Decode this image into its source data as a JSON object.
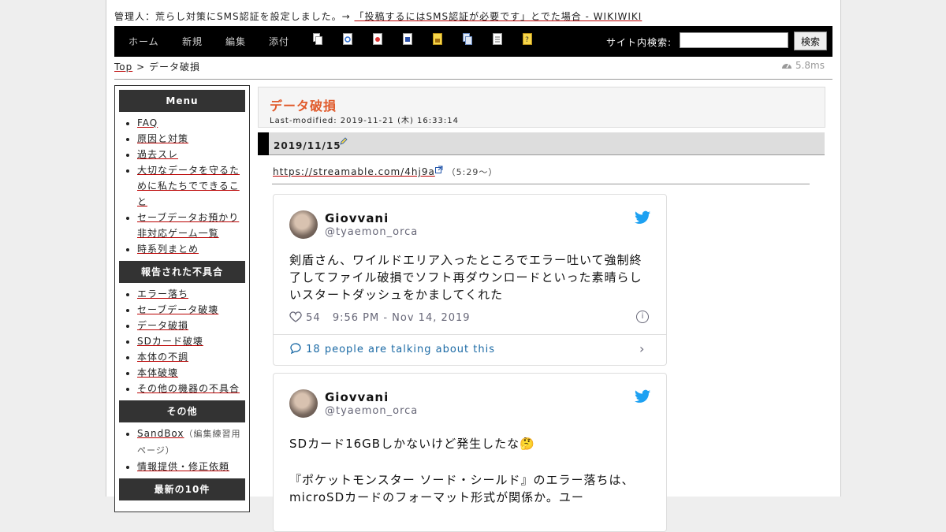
{
  "header": {
    "notice_text": "管理人：荒らし対策にSMS認証を設定しました。→",
    "notice_link": "「投稿するにはSMS認証が必要です」とでた場合 - WIKIWIKI"
  },
  "nav": {
    "links": [
      "ホーム",
      "新規",
      "編集",
      "添付"
    ],
    "search_label": "サイト内検索:",
    "search_button": "検索"
  },
  "breadcrumb": {
    "top": "Top",
    "sep": ">",
    "current": "データ破損"
  },
  "perf": {
    "time": "5.8ms"
  },
  "sidebar": {
    "sections": [
      {
        "title": "Menu",
        "items": [
          "FAQ",
          "原因と対策",
          "過去スレ",
          "大切なデータを守るために私たちでできること",
          "セーブデータお預かり非対応ゲーム一覧",
          "時系列まとめ"
        ]
      },
      {
        "title": "報告された不具合",
        "items": [
          "エラー落ち",
          "セーブデータ破壊",
          "データ破損",
          "SDカード破壊",
          "本体の不調",
          "本体破壊",
          "その他の機器の不具合"
        ]
      },
      {
        "title": "その他",
        "items": [
          "SandBox",
          "情報提供・修正依頼"
        ],
        "sandbox_note": "（編集練習用ページ）"
      },
      {
        "title": "最新の10件",
        "items": []
      }
    ]
  },
  "page": {
    "title": "データ破損",
    "last_modified": "Last-modified: 2019-11-21 (木) 16:33:14"
  },
  "section": {
    "heading": "2019/11/15",
    "link": "https://streamable.com/4hj9a",
    "link_note": "（5:29～）"
  },
  "tweets": [
    {
      "name": "Giovvani",
      "handle": "@tyaemon_orca",
      "text": "剣盾さん、ワイルドエリア入ったところでエラー吐いて強制終了してファイル破損でソフト再ダウンロードといった素晴らしいスタートダッシュをかましてくれた",
      "likes": "54",
      "time": "9:56 PM - Nov 14, 2019",
      "talk": "18 people are talking about this"
    },
    {
      "name": "Giovvani",
      "handle": "@tyaemon_orca",
      "text": "SDカード16GBしかないけど発生したな🤔",
      "text2": "『ポケットモンスター ソード・シールド』のエラー落ちは、microSDカードのフォーマット形式が関係か。ユー"
    }
  ],
  "colors": {
    "title_accent": "#e05a2b",
    "navbar": "#000000",
    "twitter_blue": "#1da1f2"
  }
}
